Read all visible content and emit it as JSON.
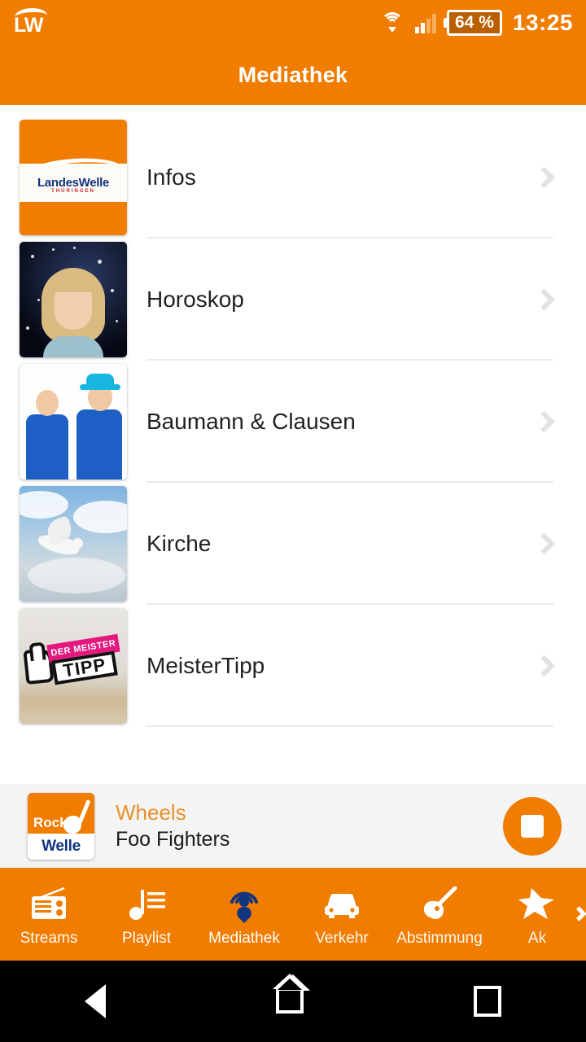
{
  "statusbar": {
    "app_badge": "LW",
    "wifi_icon": "wifi-icon",
    "signal_icon": "signal-bars-icon",
    "battery_level": "64 %",
    "time": "13:25"
  },
  "appbar": {
    "title": "Mediathek"
  },
  "list": {
    "items": [
      {
        "title": "Infos",
        "thumb": "landeswelle-logo",
        "logo_name": "LandesWelle",
        "logo_sub": "THÜRINGEN"
      },
      {
        "title": "Horoskop",
        "thumb": "horoscope-portrait"
      },
      {
        "title": "Baumann & Clausen",
        "thumb": "baumann-clausen-duo"
      },
      {
        "title": "Kirche",
        "thumb": "dove-in-sky"
      },
      {
        "title": "MeisterTipp",
        "thumb": "meistertipp-stamp",
        "stamp_top": "DER MEISTER",
        "stamp_bottom": "TIPP"
      }
    ],
    "chevron_icon": "chevron-right-icon"
  },
  "player": {
    "artwork_top": "Rock",
    "artwork_bottom": "Welle",
    "artwork_icon": "guitar-icon",
    "track_title": "Wheels",
    "track_artist": "Foo Fighters",
    "stop_button_icon": "stop-icon"
  },
  "bottomnav": {
    "items": [
      {
        "label": "Streams",
        "icon": "radio-icon",
        "active": false
      },
      {
        "label": "Playlist",
        "icon": "music-note-icon",
        "active": false
      },
      {
        "label": "Mediathek",
        "icon": "podcast-icon",
        "active": true
      },
      {
        "label": "Verkehr",
        "icon": "car-icon",
        "active": false
      },
      {
        "label": "Abstimmung",
        "icon": "guitar-icon",
        "active": false
      },
      {
        "label": "Ak",
        "icon": "star-icon",
        "active": false
      }
    ],
    "scroll_chevron": "chevron-right-icon"
  },
  "androidnav": {
    "back": "back-icon",
    "home": "home-icon",
    "recents": "recents-icon"
  },
  "colors": {
    "brand_orange": "#f07d00",
    "accent_blue": "#12357f",
    "track_title": "#e8922c"
  }
}
